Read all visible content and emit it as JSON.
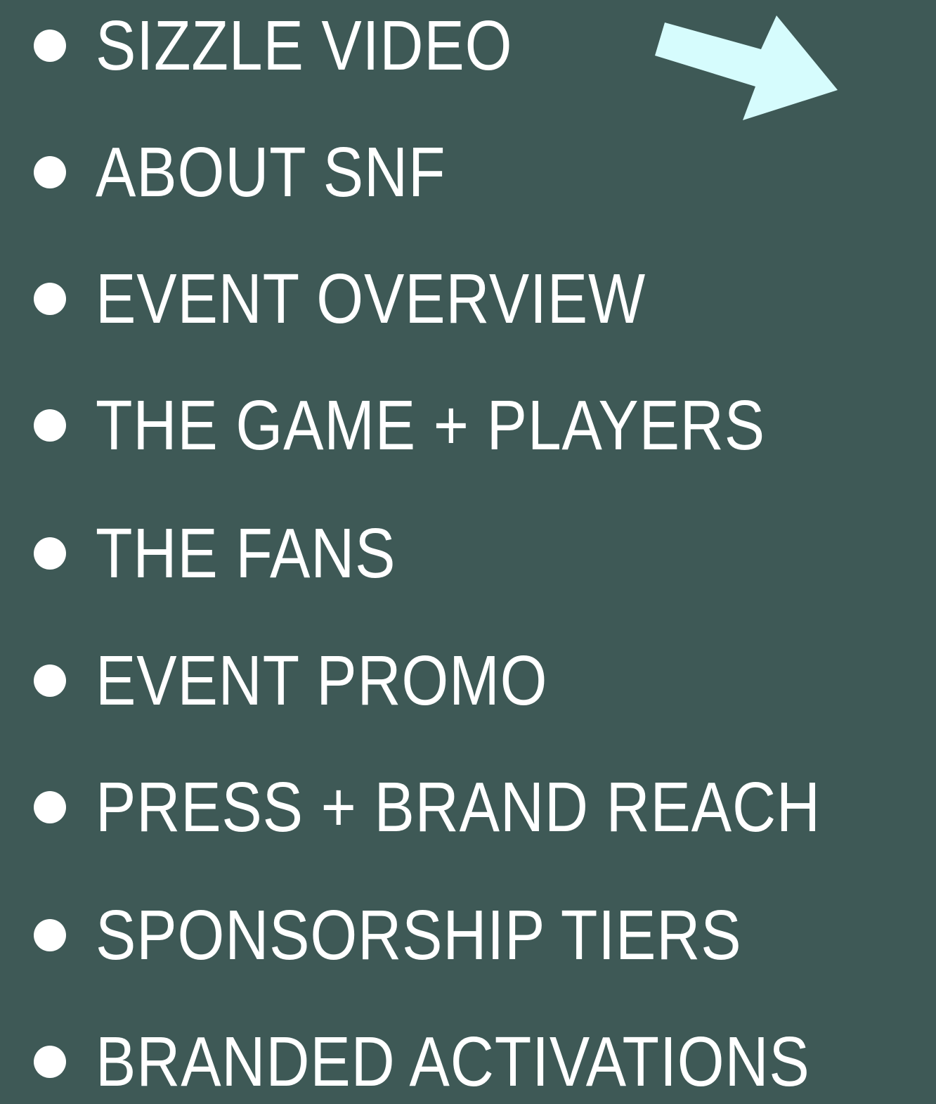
{
  "colors": {
    "background": "#3e5956",
    "text": "#ffffff",
    "bullet": "#ffffff",
    "arrow": "#d6fcfd"
  },
  "arrow": {
    "icon": "arrow-right-down-icon",
    "points_to": "sizzle-video"
  },
  "menu": {
    "items": [
      {
        "label": "SIZZLE VIDEO"
      },
      {
        "label": "ABOUT SNF"
      },
      {
        "label": "EVENT OVERVIEW"
      },
      {
        "label": "THE GAME + PLAYERS"
      },
      {
        "label": "THE FANS"
      },
      {
        "label": "EVENT PROMO"
      },
      {
        "label": "PRESS + BRAND REACH"
      },
      {
        "label": "SPONSORSHIP TIERS"
      },
      {
        "label": "BRANDED ACTIVATIONS"
      }
    ]
  }
}
